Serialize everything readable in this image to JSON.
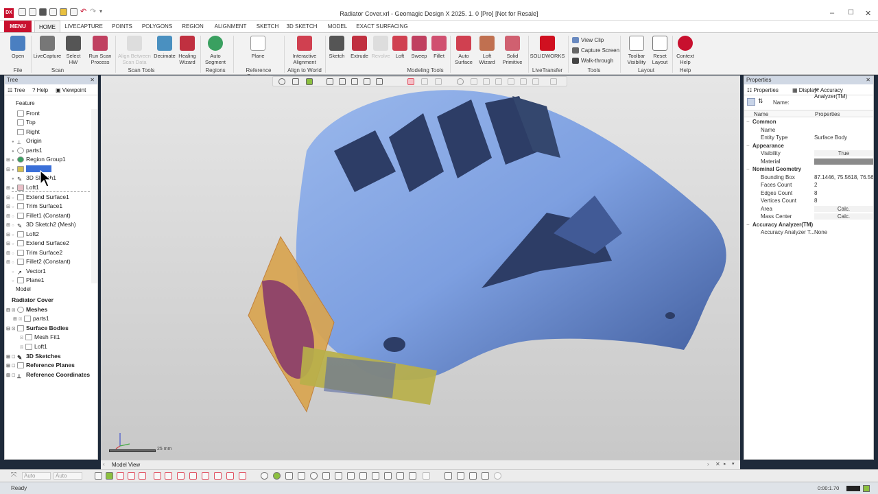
{
  "titlebar": {
    "title": "Radiator Cover.xrl - Geomagic Design X 2025. 1. 0 [Pro] [Not for Resale]",
    "logo": "DX"
  },
  "menu_tabs": [
    "MENU",
    "HOME",
    "LIVECAPTURE",
    "POINTS",
    "POLYGONS",
    "REGION",
    "ALIGNMENT",
    "SKETCH",
    "3D SKETCH",
    "MODEL",
    "EXACT SURFACING"
  ],
  "ribbon": {
    "buttons": [
      {
        "label": "Open",
        "color": "#4a7fc1"
      },
      {
        "label": "LiveCapture",
        "color": "#777777"
      },
      {
        "label": "Select HW",
        "color": "#555555"
      },
      {
        "label": "Run Scan Process",
        "color": "#c04060"
      },
      {
        "label": "Align Between Scan Data",
        "color": "#cccccc"
      },
      {
        "label": "Decimate",
        "color": "#4a90c0"
      },
      {
        "label": "Healing Wizard",
        "color": "#c03040"
      },
      {
        "label": "Auto Segment",
        "color": "#3aa060"
      },
      {
        "label": "Plane",
        "color": "#999999"
      },
      {
        "label": "Interactive Alignment",
        "color": "#d04050"
      },
      {
        "label": "Sketch",
        "color": "#555555"
      },
      {
        "label": "Extrude",
        "color": "#c03040"
      },
      {
        "label": "Revolve",
        "color": "#cccccc"
      },
      {
        "label": "Loft",
        "color": "#d04050"
      },
      {
        "label": "Sweep",
        "color": "#c04060"
      },
      {
        "label": "Fillet",
        "color": "#d05070"
      },
      {
        "label": "Auto Surface",
        "color": "#d04050"
      },
      {
        "label": "Loft Wizard",
        "color": "#c07050"
      },
      {
        "label": "Solid Primitive",
        "color": "#d06070"
      },
      {
        "label": "SOLIDWORKS",
        "color": "#d01020"
      },
      {
        "label": "Toolbar Visibility",
        "color": "#888888"
      },
      {
        "label": "Reset Layout",
        "color": "#777777"
      },
      {
        "label": "Context Help",
        "color": "#c8102e"
      }
    ],
    "small_buttons": [
      "View Clip",
      "Capture Screen",
      "Walk-through"
    ],
    "groups": [
      "File",
      "Scan",
      "Scan Tools",
      "Regions",
      "Reference Geometry",
      "Align to World",
      "Modeling Tools",
      "LiveTransfer",
      "Tools",
      "Layout",
      "Help"
    ]
  },
  "tree_panel": {
    "title": "Tree",
    "tabs": [
      "Tree",
      "Help",
      "Viewpoint"
    ],
    "feature_label": "Feature",
    "features": [
      {
        "label": "Front"
      },
      {
        "label": "Top"
      },
      {
        "label": "Right"
      },
      {
        "label": "Origin"
      },
      {
        "label": "parts1"
      },
      {
        "label": "Region Group1"
      },
      {
        "label": "Mesh Fit1"
      },
      {
        "label": "3D Sketch1"
      },
      {
        "label": "Loft1"
      },
      {
        "label": "Extend Surface1"
      },
      {
        "label": "Trim Surface1"
      },
      {
        "label": "Fillet1 (Constant)"
      },
      {
        "label": "3D Sketch2 (Mesh)"
      },
      {
        "label": "Loft2"
      },
      {
        "label": "Extend Surface2"
      },
      {
        "label": "Trim Surface2"
      },
      {
        "label": "Fillet2 (Constant)"
      },
      {
        "label": "Vector1"
      },
      {
        "label": "Plane1"
      }
    ],
    "model_label": "Model",
    "model_items": [
      {
        "label": "Radiator Cover"
      },
      {
        "label": "Meshes"
      },
      {
        "label": "parts1"
      },
      {
        "label": "Surface Bodies"
      },
      {
        "label": "Mesh Fit1"
      },
      {
        "label": "Loft1"
      },
      {
        "label": "3D Sketches"
      },
      {
        "label": "Reference Planes"
      },
      {
        "label": "Reference Coordinates"
      }
    ]
  },
  "viewport": {
    "scale_label": "25 mm",
    "tab_label": "Model View",
    "model_color": "#7d9fe0"
  },
  "properties_panel": {
    "title": "Properties",
    "tabs": [
      "Properties",
      "Display",
      "Accuracy Analyzer(TM)"
    ],
    "name_label": "Name:",
    "columns": [
      "Name",
      "Properties"
    ],
    "rows": [
      {
        "section": "Common",
        "name": "",
        "value": ""
      },
      {
        "section": "",
        "name": "Name",
        "value": ""
      },
      {
        "section": "",
        "name": "Entity Type",
        "value": "Surface Body"
      },
      {
        "section": "Appearance",
        "name": "",
        "value": ""
      },
      {
        "section": "",
        "name": "Visibility",
        "value": "True"
      },
      {
        "section": "",
        "name": "Material",
        "value": ""
      },
      {
        "section": "Nominal Geometry",
        "name": "",
        "value": ""
      },
      {
        "section": "",
        "name": "Bounding Box",
        "value": "87.1446, 75.5618, 76.56..."
      },
      {
        "section": "",
        "name": "Faces Count",
        "value": "2"
      },
      {
        "section": "",
        "name": "Edges Count",
        "value": "8"
      },
      {
        "section": "",
        "name": "Vertices Count",
        "value": "8"
      },
      {
        "section": "",
        "name": "Area",
        "value": "Calc."
      },
      {
        "section": "",
        "name": "Mass Center",
        "value": "Calc."
      },
      {
        "section": "Accuracy Analyzer(TM)",
        "name": "",
        "value": ""
      },
      {
        "section": "",
        "name": "Accuracy Analyzer T...",
        "value": "None"
      }
    ]
  },
  "bottom_toolbar": {
    "auto1": "Auto",
    "auto2": "Auto"
  },
  "status": {
    "text": "Ready",
    "time": "0:00:1.70"
  }
}
